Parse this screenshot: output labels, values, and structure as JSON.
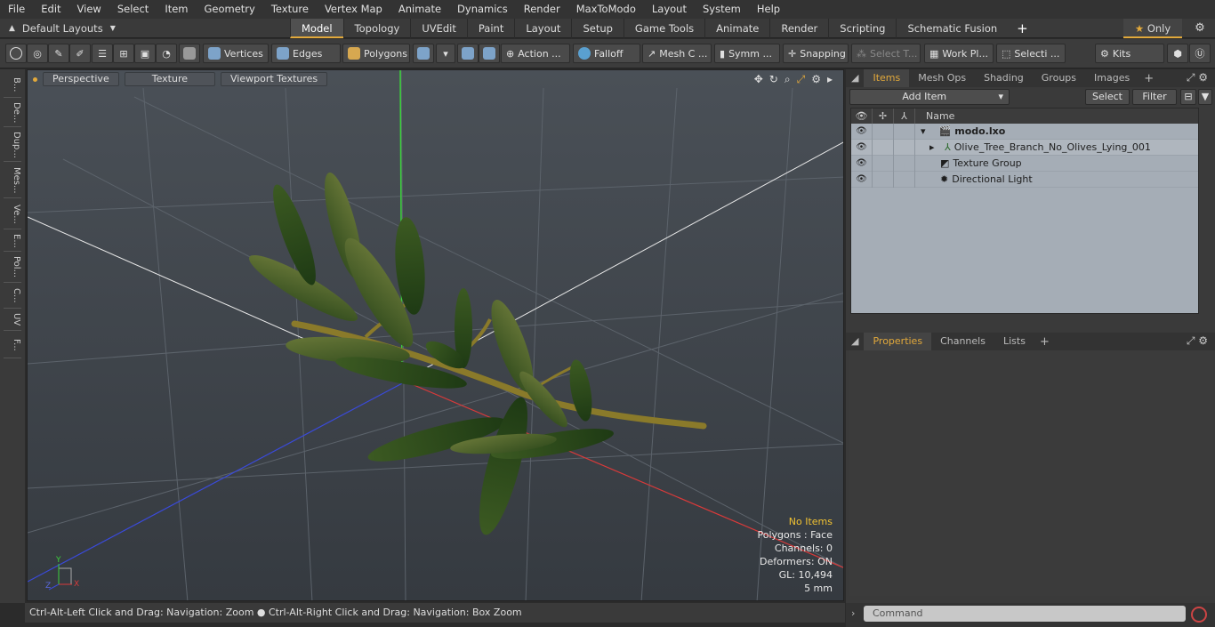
{
  "menu": [
    "File",
    "Edit",
    "View",
    "Select",
    "Item",
    "Geometry",
    "Texture",
    "Vertex Map",
    "Animate",
    "Dynamics",
    "Render",
    "MaxToModo",
    "Layout",
    "System",
    "Help"
  ],
  "layouts": {
    "label": "Default Layouts"
  },
  "tabs": [
    "Model",
    "Topology",
    "UVEdit",
    "Paint",
    "Layout",
    "Setup",
    "Game Tools",
    "Animate",
    "Render",
    "Scripting",
    "Schematic Fusion"
  ],
  "active_tab": "Model",
  "only_label": "Only",
  "toolbar": {
    "vertices": "Vertices",
    "edges": "Edges",
    "polygons": "Polygons",
    "action": "Action ...",
    "falloff": "Falloff",
    "mesh": "Mesh C ...",
    "symm": "Symm ...",
    "snapping": "Snapping",
    "select_t": "Select T...",
    "work_pl": "Work Pl...",
    "selecti": "Selecti ...",
    "kits": "Kits"
  },
  "left_tabs": [
    "B...",
    "De...",
    "Dup...",
    "Mes...",
    "Ve...",
    "E...",
    "Pol...",
    "C...",
    "UV",
    "F..."
  ],
  "viewport": {
    "perspective": "Perspective",
    "texture": "Texture",
    "viewport_textures": "Viewport Textures",
    "info": {
      "no_items": "No Items",
      "polygons": "Polygons : Face",
      "channels": "Channels: 0",
      "deformers": "Deformers: ON",
      "gl": "GL: 10,494",
      "units": "5 mm"
    }
  },
  "statusbar": {
    "text": "Ctrl-Alt-Left Click and Drag: Navigation: Zoom ● Ctrl-Alt-Right Click and Drag: Navigation: Box Zoom"
  },
  "items_panel": {
    "tabs": [
      "Items",
      "Mesh Ops",
      "Shading",
      "Groups",
      "Images"
    ],
    "add_item": "Add Item",
    "select": "Select",
    "filter": "Filter",
    "name_header": "Name",
    "rows": [
      {
        "name": "modo.lxo"
      },
      {
        "name": "Olive_Tree_Branch_No_Olives_Lying_001"
      },
      {
        "name": "Texture Group"
      },
      {
        "name": "Directional Light"
      }
    ]
  },
  "props_panel": {
    "tabs": [
      "Properties",
      "Channels",
      "Lists"
    ]
  },
  "command": {
    "placeholder": "Command"
  },
  "colors": {
    "accent": "#e2a93b",
    "x_axis": "#d93a3a",
    "y_axis": "#3cd23c",
    "z_axis": "#3a4ad9"
  }
}
